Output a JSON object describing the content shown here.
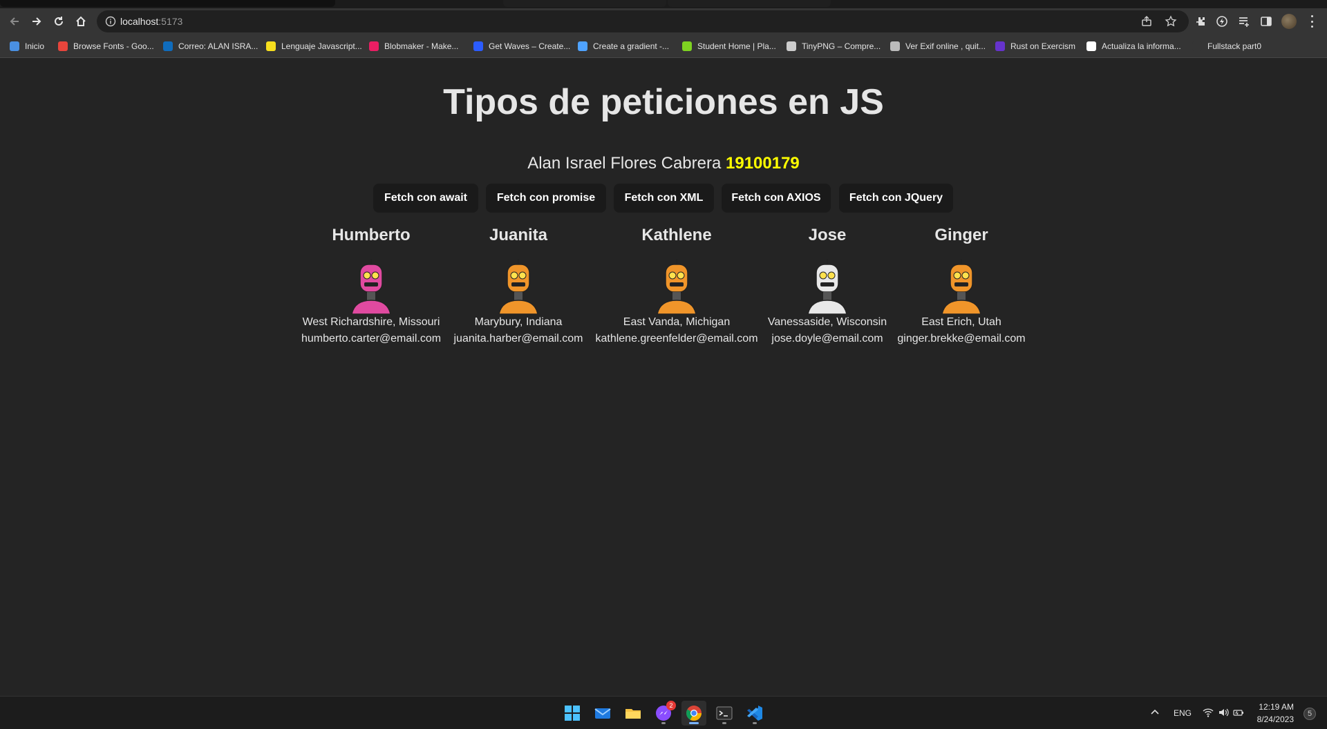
{
  "browser": {
    "url_host": "localhost",
    "url_port": ":5173"
  },
  "bookmarks": [
    {
      "label": "Inicio",
      "color": "#4a90e2"
    },
    {
      "label": "Browse Fonts - Goo...",
      "color": "#e8453c"
    },
    {
      "label": "Correo: ALAN ISRA...",
      "color": "#0f6cbd"
    },
    {
      "label": "Lenguaje Javascript...",
      "color": "#f7df1e"
    },
    {
      "label": "Blobmaker - Make...",
      "color": "#e91e63"
    },
    {
      "label": "Get Waves – Create...",
      "color": "#2b5cff"
    },
    {
      "label": "Create a gradient -...",
      "color": "#4fa3ff"
    },
    {
      "label": "Student Home | Pla...",
      "color": "#7ed321"
    },
    {
      "label": "TinyPNG – Compre...",
      "color": "#cccccc"
    },
    {
      "label": "Ver Exif online , quit...",
      "color": "#bbbbbb"
    },
    {
      "label": "Rust on Exercism",
      "color": "#6633cc"
    },
    {
      "label": "Actualiza la informa...",
      "color": "#ffffff"
    },
    {
      "label": "Fullstack part0",
      "color": "#353535"
    }
  ],
  "page": {
    "title": "Tipos de peticiones en JS",
    "author": "Alan Israel Flores Cabrera",
    "student_id": "19100179",
    "buttons": [
      "Fetch con await",
      "Fetch con promise",
      "Fetch con XML",
      "Fetch con AXIOS",
      "Fetch con JQuery"
    ],
    "users": [
      {
        "name": "Humberto",
        "location": "West Richardshire, Missouri",
        "email": "humberto.carter@email.com",
        "robot_color": "#e04aa0"
      },
      {
        "name": "Juanita",
        "location": "Marybury, Indiana",
        "email": "juanita.harber@email.com",
        "robot_color": "#f0952a"
      },
      {
        "name": "Kathlene",
        "location": "East Vanda, Michigan",
        "email": "kathlene.greenfelder@email.com",
        "robot_color": "#f0952a"
      },
      {
        "name": "Jose",
        "location": "Vanessaside, Wisconsin",
        "email": "jose.doyle@email.com",
        "robot_color": "#e8e8e8"
      },
      {
        "name": "Ginger",
        "location": "East Erich, Utah",
        "email": "ginger.brekke@email.com",
        "robot_color": "#f0952a"
      }
    ]
  },
  "taskbar": {
    "apps": [
      "start-icon",
      "mail-icon",
      "file-explorer-icon",
      "messenger-icon",
      "chrome-icon",
      "terminal-icon",
      "vscode-icon"
    ],
    "messenger_badge": "2",
    "lang": "ENG",
    "time": "12:19 AM",
    "date": "8/24/2023",
    "notifications": "5"
  }
}
